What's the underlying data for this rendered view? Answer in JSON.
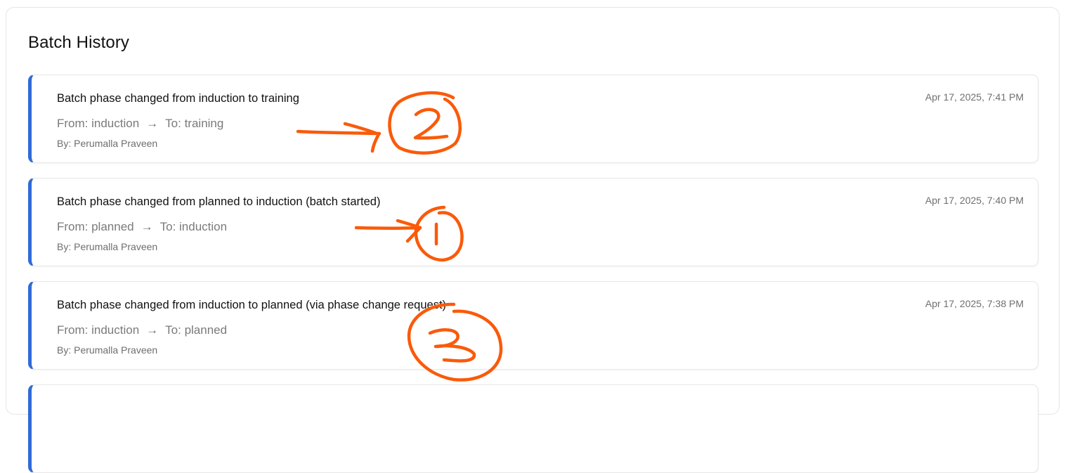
{
  "panel": {
    "title": "Batch History"
  },
  "entries": [
    {
      "title": "Batch phase changed from induction to training",
      "timestamp": "Apr 17, 2025, 7:41 PM",
      "from_label": "From: induction",
      "arrow": "→",
      "to_label": "To: training",
      "by": "By: Perumalla Praveen"
    },
    {
      "title": "Batch phase changed from planned to induction (batch started)",
      "timestamp": "Apr 17, 2025, 7:40 PM",
      "from_label": "From: planned",
      "arrow": "→",
      "to_label": "To: induction",
      "by": "By: Perumalla Praveen"
    },
    {
      "title": "Batch phase changed from induction to planned (via phase change request)",
      "timestamp": "Apr 17, 2025, 7:38 PM",
      "from_label": "From: induction",
      "arrow": "→",
      "to_label": "To: planned",
      "by": "By: Perumalla Praveen"
    }
  ],
  "annotations": {
    "color": "#fa5a0a",
    "numbers": [
      "2",
      "1",
      "3"
    ]
  },
  "colors": {
    "entry_accent": "#2f6bd8",
    "annotation_ink": "#fa5a0a"
  }
}
